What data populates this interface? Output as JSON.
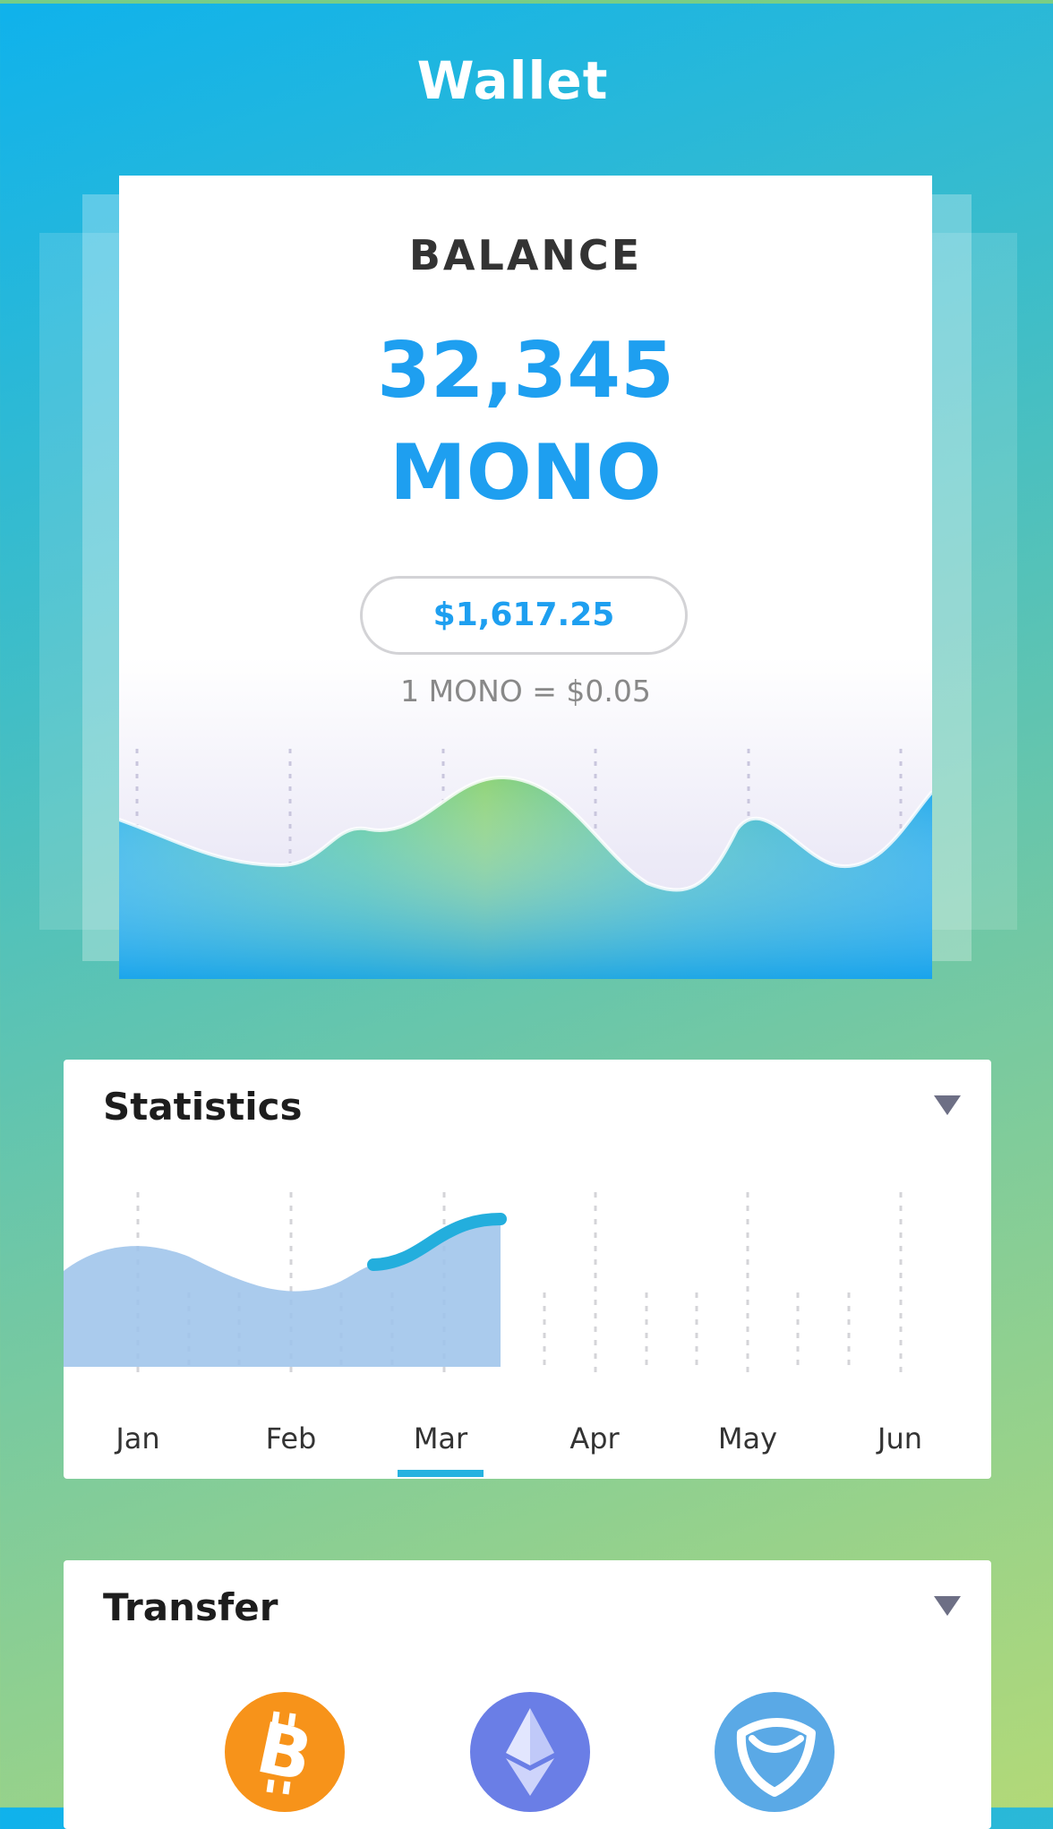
{
  "header": {
    "title": "Wallet"
  },
  "balance": {
    "label": "BALANCE",
    "amount": "32,345",
    "unit": "MONO",
    "usd_value": "$1,617.25",
    "rate": "1 MONO = $0.05"
  },
  "statistics": {
    "title": "Statistics",
    "months": [
      "Jan",
      "Feb",
      "Mar",
      "Apr",
      "May",
      "Jun"
    ],
    "selected_month": "Mar"
  },
  "transfer": {
    "title": "Transfer",
    "coins": [
      {
        "name": "bitcoin",
        "icon": "bitcoin-icon",
        "color": "#f7931a"
      },
      {
        "name": "ethereum",
        "icon": "ethereum-icon",
        "color": "#6a7ee6"
      },
      {
        "name": "nem",
        "icon": "nem-icon",
        "color": "#5aa9e6"
      }
    ]
  },
  "colors": {
    "accent": "#1e9ff0",
    "highlight": "#26b2e0",
    "background_start": "#0fb2ec",
    "background_end": "#b2d978"
  }
}
